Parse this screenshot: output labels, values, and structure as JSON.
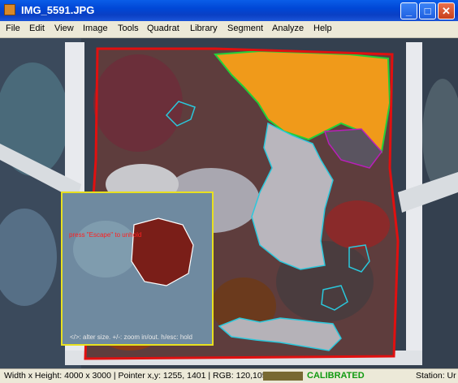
{
  "window": {
    "title": "IMG_5591.JPG",
    "minimize_glyph": "_",
    "maximize_glyph": "□",
    "close_glyph": "✕"
  },
  "menu": [
    "File",
    "Edit",
    "View",
    "Image",
    "Tools",
    "Quadrat",
    "Library",
    "Segment",
    "Analyze",
    "Help"
  ],
  "overlay": {
    "hint_top": "press \"Escape\" to unhold",
    "hint_bottom": "</>: alter size. +/-: zoom in/out. h/esc: hold"
  },
  "status": {
    "info": "Width x Height: 4000 x 3000 | Pointer x,y: 1255, 1401 | RGB: 120,105, 50",
    "swatch_color": "#786932",
    "calibration": "CALIBRATED",
    "station": "Station: Ur"
  },
  "colors": {
    "quadrat_outline": "#e01010",
    "sponge_outline": "#22d03a",
    "coral_outline": "#2ac8dc",
    "magnifier_border": "#e8e020",
    "selection_outline": "#ffffff"
  },
  "icons": [
    "matlab-figure-icon",
    "minimize-icon",
    "maximize-icon",
    "close-icon"
  ]
}
